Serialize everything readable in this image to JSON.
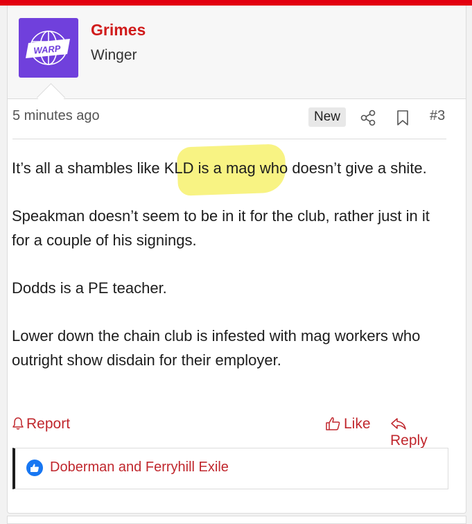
{
  "author": {
    "username": "Grimes",
    "title": "Winger",
    "avatar_text": "WARP"
  },
  "post": {
    "timestamp": "5 minutes ago",
    "badge": "New",
    "number": "#3",
    "paragraphs": [
      "It’s all a shambles like KLD is a mag who doesn’t give a shite.",
      "Speakman doesn’t seem to be in it for the club, rather just in it for a couple of his signings.",
      "Dodds is a PE teacher.",
      "Lower down the chain club is infested with mag workers who outright show disdain for their employer."
    ]
  },
  "actions": {
    "report": "Report",
    "like": "Like",
    "reply": "Reply"
  },
  "reactions": {
    "text": "Doberman and Ferryhill Exile"
  },
  "colors": {
    "accent": "#c0272d",
    "topbar": "#e3000f",
    "avatar_bg": "#7040dc",
    "highlight": "#f6f064",
    "like_blue": "#1877f2"
  }
}
